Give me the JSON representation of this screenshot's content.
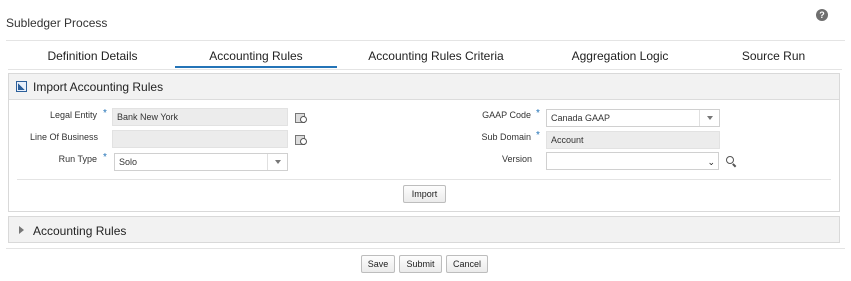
{
  "page": {
    "title": "Subledger Process",
    "help_glyph": "?"
  },
  "tabs": [
    {
      "label": "Definition Details"
    },
    {
      "label": "Accounting Rules",
      "active": true
    },
    {
      "label": "Accounting Rules Criteria"
    },
    {
      "label": "Aggregation Logic"
    },
    {
      "label": "Source Run"
    }
  ],
  "import_panel": {
    "title": "Import Accounting Rules",
    "required_marker": "*",
    "fields": {
      "legal_entity": {
        "label": "Legal Entity",
        "value": "Bank New York",
        "required": true
      },
      "line_of_business": {
        "label": "Line Of Business",
        "value": "",
        "required": false
      },
      "run_type": {
        "label": "Run Type",
        "value": "Solo",
        "required": true
      },
      "gaap_code": {
        "label": "GAAP Code",
        "value": "Canada GAAP",
        "required": true
      },
      "sub_domain": {
        "label": "Sub Domain",
        "value": "Account",
        "required": true
      },
      "version": {
        "label": "Version",
        "value": "",
        "required": false
      }
    },
    "import_button": "Import"
  },
  "rules_panel": {
    "title": "Accounting Rules",
    "expanded": false
  },
  "footer": {
    "save": "Save",
    "submit": "Submit",
    "cancel": "Cancel"
  },
  "colors": {
    "accent": "#2474b7",
    "panel_header_bg": "#f2f2f2",
    "readonly_field_bg": "#ececec"
  }
}
